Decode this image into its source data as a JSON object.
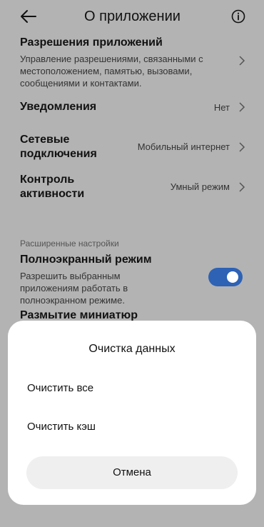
{
  "header": {
    "title": "О приложении",
    "back_icon": "arrow-left-icon",
    "info_icon": "info-circle-icon"
  },
  "rows": {
    "permissions": {
      "title": "Разрешения приложений",
      "description": "Управление разрешениями, связанными с местоположением, памятью, вызовами, сообщениями и контактами."
    },
    "notifications": {
      "title": "Уведомления",
      "value": "Нет"
    },
    "network": {
      "title": "Сетевые подключения",
      "value": "Мобильный интернет"
    },
    "activity": {
      "title": "Контроль активности",
      "value": "Умный режим"
    }
  },
  "advanced": {
    "section_label": "Расширенные настройки",
    "fullscreen": {
      "title": "Полноэкранный режим",
      "description": "Разрешить выбранным приложениям работать в полноэкранном режиме.",
      "enabled": true
    },
    "blur_title": "Размытие миниатюр"
  },
  "dialog": {
    "title": "Очистка данных",
    "options": [
      "Очистить все",
      "Очистить кэш"
    ],
    "cancel_label": "Отмена"
  },
  "colors": {
    "toggle_on": "#2d62b5",
    "dialog_bg": "#ffffff",
    "cancel_bg": "#efefef"
  }
}
